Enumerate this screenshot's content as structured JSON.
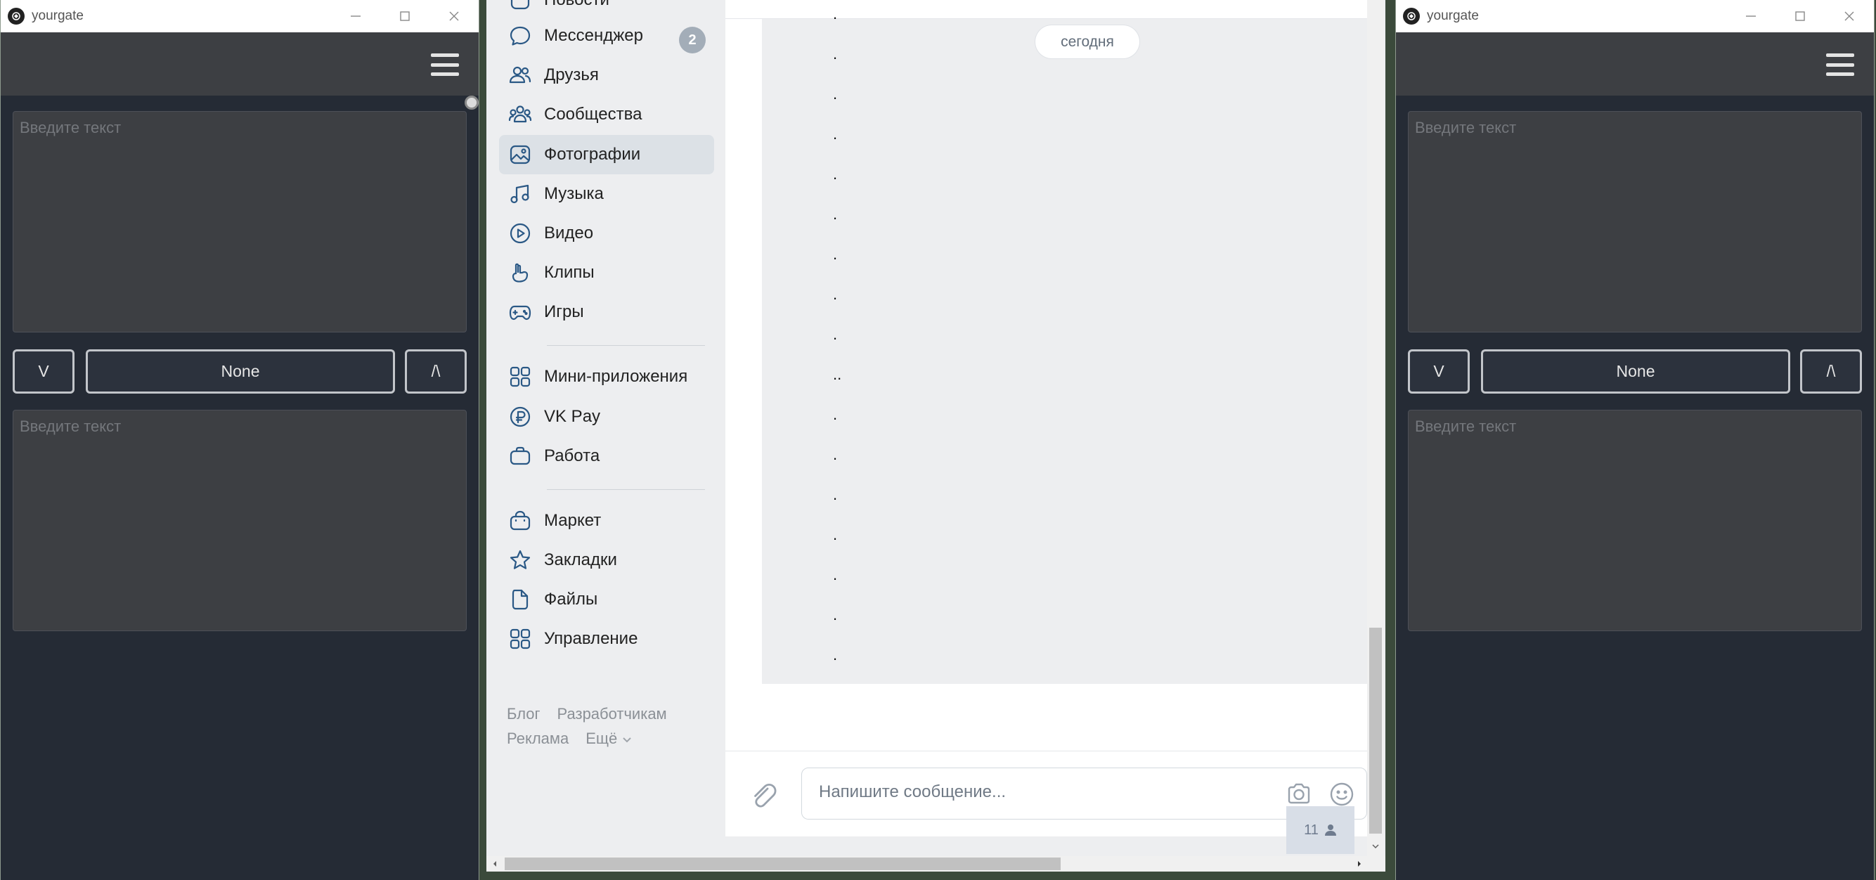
{
  "left_window": {
    "title": "yourgate",
    "top_text_placeholder": "Введите текст",
    "bottom_text_placeholder": "Введите текст",
    "down_button": "V",
    "center_button": "None",
    "up_button": "/\\"
  },
  "right_window": {
    "title": "yourgate",
    "top_text_placeholder": "Введите текст",
    "bottom_text_placeholder": "Введите текст",
    "down_button": "V",
    "center_button": "None",
    "up_button": "/\\"
  },
  "sidebar": {
    "items": [
      {
        "label": "Новости",
        "icon": "news-icon"
      },
      {
        "label": "Мессенджер",
        "icon": "message-bubble-icon",
        "badge": "2"
      },
      {
        "label": "Друзья",
        "icon": "friends-icon"
      },
      {
        "label": "Сообщества",
        "icon": "communities-icon"
      },
      {
        "label": "Фотографии",
        "icon": "photos-icon",
        "active": true
      },
      {
        "label": "Музыка",
        "icon": "music-icon"
      },
      {
        "label": "Видео",
        "icon": "video-icon"
      },
      {
        "label": "Клипы",
        "icon": "clips-icon"
      },
      {
        "label": "Игры",
        "icon": "gamepad-icon"
      },
      {
        "label": "Мини-приложения",
        "icon": "mini-apps-icon"
      },
      {
        "label": "VK Pay",
        "icon": "vk-pay-icon"
      },
      {
        "label": "Работа",
        "icon": "briefcase-icon"
      },
      {
        "label": "Маркет",
        "icon": "market-bag-icon"
      },
      {
        "label": "Закладки",
        "icon": "star-icon"
      },
      {
        "label": "Файлы",
        "icon": "file-icon"
      },
      {
        "label": "Управление",
        "icon": "manage-grid-icon"
      }
    ],
    "footer": {
      "blog": "Блог",
      "developers": "Разработчикам",
      "ads": "Реклама",
      "more": "Ещё"
    }
  },
  "chat": {
    "date_separator": "сегодня",
    "messages": [
      ".",
      ".",
      ".",
      ".",
      ".",
      ".",
      ".",
      ".",
      ".",
      "..",
      ".",
      ".",
      ".",
      ".",
      ".",
      ".",
      "."
    ],
    "composer_placeholder": "Напишите сообщение...",
    "online_count": "11"
  },
  "colors": {
    "vk_blue": "#2a5885",
    "page_bg": "#edeef0",
    "yg_bg": "#252b35"
  }
}
